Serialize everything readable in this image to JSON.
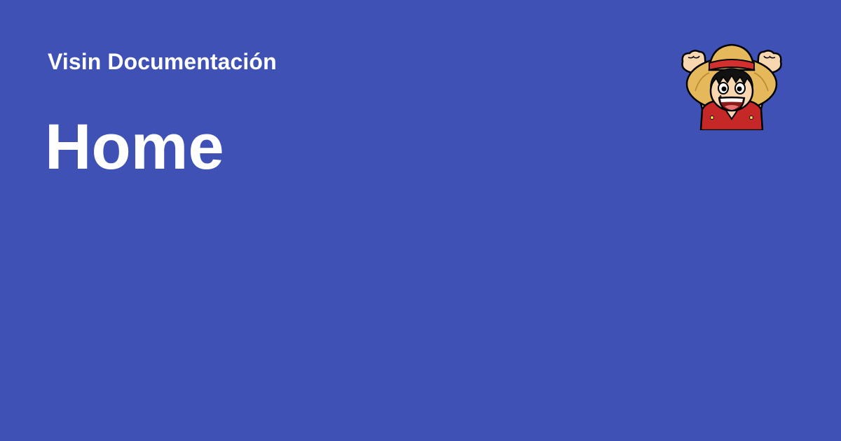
{
  "site": {
    "name": "Visin Documentación"
  },
  "page": {
    "title": "Home"
  },
  "logo": {
    "icon": "straw-hat-character-logo-icon"
  },
  "colors": {
    "background": "#3f51b5",
    "text": "#ffffff",
    "hat": "#e6b85c",
    "hat_band": "#d32f2f",
    "shirt": "#c62828",
    "skin": "#f8d7b0"
  }
}
